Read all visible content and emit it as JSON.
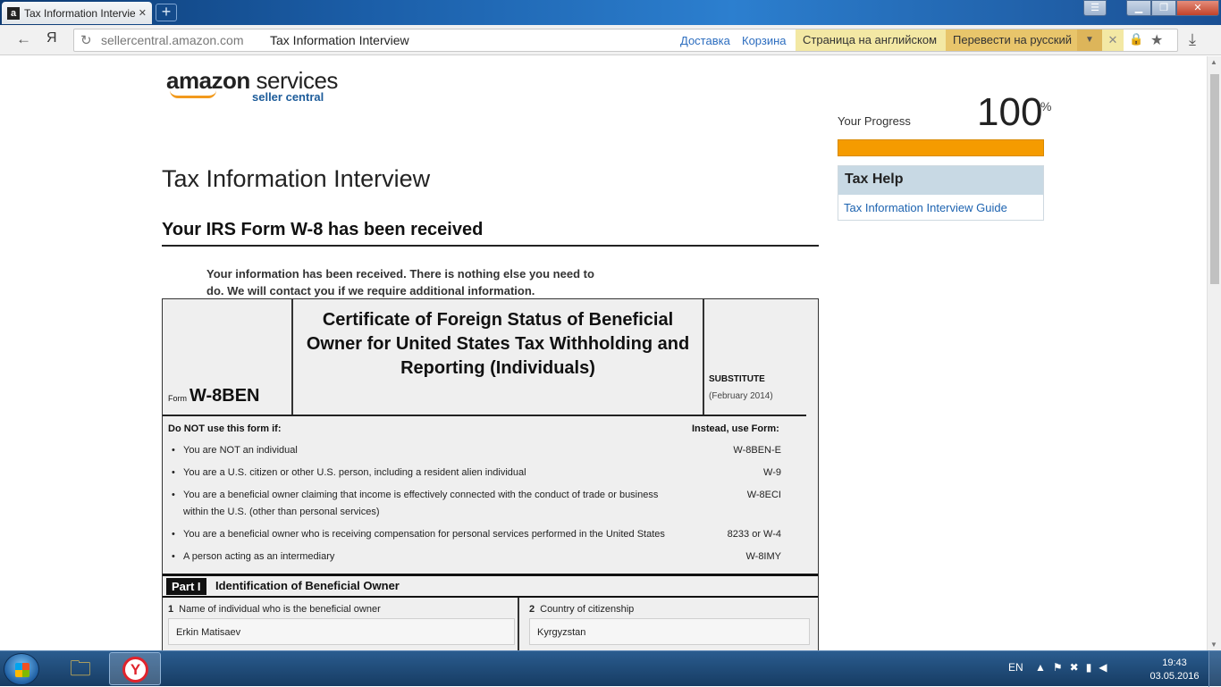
{
  "browser": {
    "tab_title": "Tax Information Interview",
    "tab_favicon": "a",
    "new_tab": "+",
    "back_icon": "←",
    "yandex_icon": "Я",
    "url_domain": "sellercentral.amazon.com",
    "url_page_title": "Tax Information Interview",
    "quick_link_1": "Доставка",
    "quick_link_2": "Корзина",
    "translate_english": "Страница на английском",
    "translate_russian": "Перевести на русский"
  },
  "logo": {
    "amazon": "amazon",
    "services": "services",
    "seller_central": "seller central"
  },
  "page": {
    "title": "Tax Information Interview",
    "subtitle": "Your IRS Form W-8 has been received",
    "received_message": "Your information has been received. There is nothing else you need to do. We will contact you if we require additional information."
  },
  "progress": {
    "label": "Your Progress",
    "value": "100",
    "percent_sign": "%",
    "fraction": 1.0,
    "color": "#f59b00"
  },
  "tax_help": {
    "header": "Tax Help",
    "guide_link": "Tax Information Interview Guide"
  },
  "form": {
    "form_label": "Form",
    "form_number": "W-8BEN",
    "title": "Certificate of Foreign Status of Beneficial Owner for United States Tax Withholding and Reporting (Individuals)",
    "substitute": "SUBSTITUTE",
    "date": "(February 2014)",
    "do_not_use": "Do NOT use this form if:",
    "instead_use": "Instead, use Form:",
    "conditions": [
      {
        "text": "You are NOT an individual",
        "form": "W-8BEN-E"
      },
      {
        "text": "You are a U.S. citizen or other U.S. person, including a resident alien individual",
        "form": "W-9"
      },
      {
        "text": "You are a beneficial owner claiming that income is effectively connected with the conduct of trade or business within the U.S. (other than personal services)",
        "form": "W-8ECI"
      },
      {
        "text": "You are a beneficial owner who is receiving compensation for personal services performed in the United States",
        "form": "8233 or W-4"
      },
      {
        "text": "A person acting as an intermediary",
        "form": "W-8IMY"
      }
    ],
    "part_badge": "Part I",
    "part_title": "Identification of Beneficial Owner",
    "field1_number": "1",
    "field1_label": "Name of individual who is the beneficial owner",
    "field1_value": "Erkin Matisaev",
    "field2_number": "2",
    "field2_label": "Country of citizenship",
    "field2_value": "Kyrgyzstan"
  },
  "taskbar": {
    "language": "EN",
    "time": "19:43",
    "date": "03.05.2016"
  }
}
